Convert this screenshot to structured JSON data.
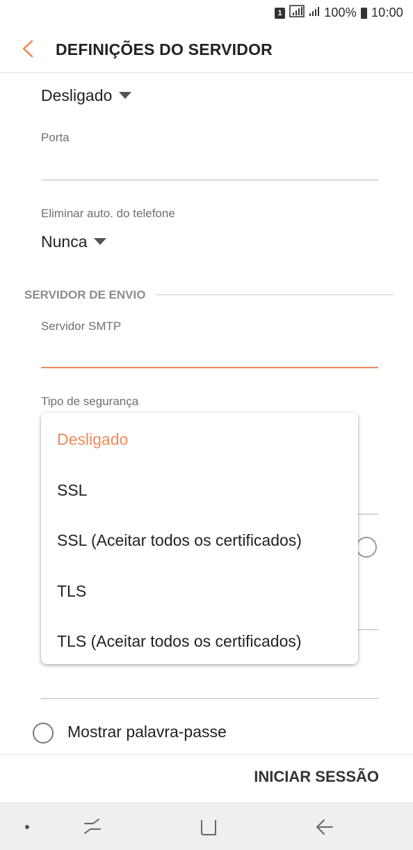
{
  "status_bar": {
    "sim_badge": "1",
    "battery_percent": "100%",
    "time": "10:00"
  },
  "header": {
    "title": "DEFINIÇÕES DO SERVIDOR"
  },
  "incoming": {
    "security_value": "Desligado",
    "port_label": "Porta",
    "port_value": "",
    "delete_label": "Eliminar auto. do telefone",
    "delete_value": "Nunca"
  },
  "outgoing": {
    "section_title": "SERVIDOR DE ENVIO",
    "smtp_label": "Servidor SMTP",
    "smtp_value": "",
    "security_label": "Tipo de segurança"
  },
  "security_dropdown": {
    "selected": "Desligado",
    "options": [
      "Desligado",
      "SSL",
      "SSL (Aceitar todos os certificados)",
      "TLS",
      "TLS (Aceitar todos os certificados)"
    ]
  },
  "show_password": {
    "label": "Mostrar palavra-passe",
    "checked": false
  },
  "footer": {
    "login_label": "INICIAR SESSÃO"
  },
  "colors": {
    "accent": "#ef8a5a",
    "text": "#222222",
    "nav_background": "#efeff1"
  }
}
